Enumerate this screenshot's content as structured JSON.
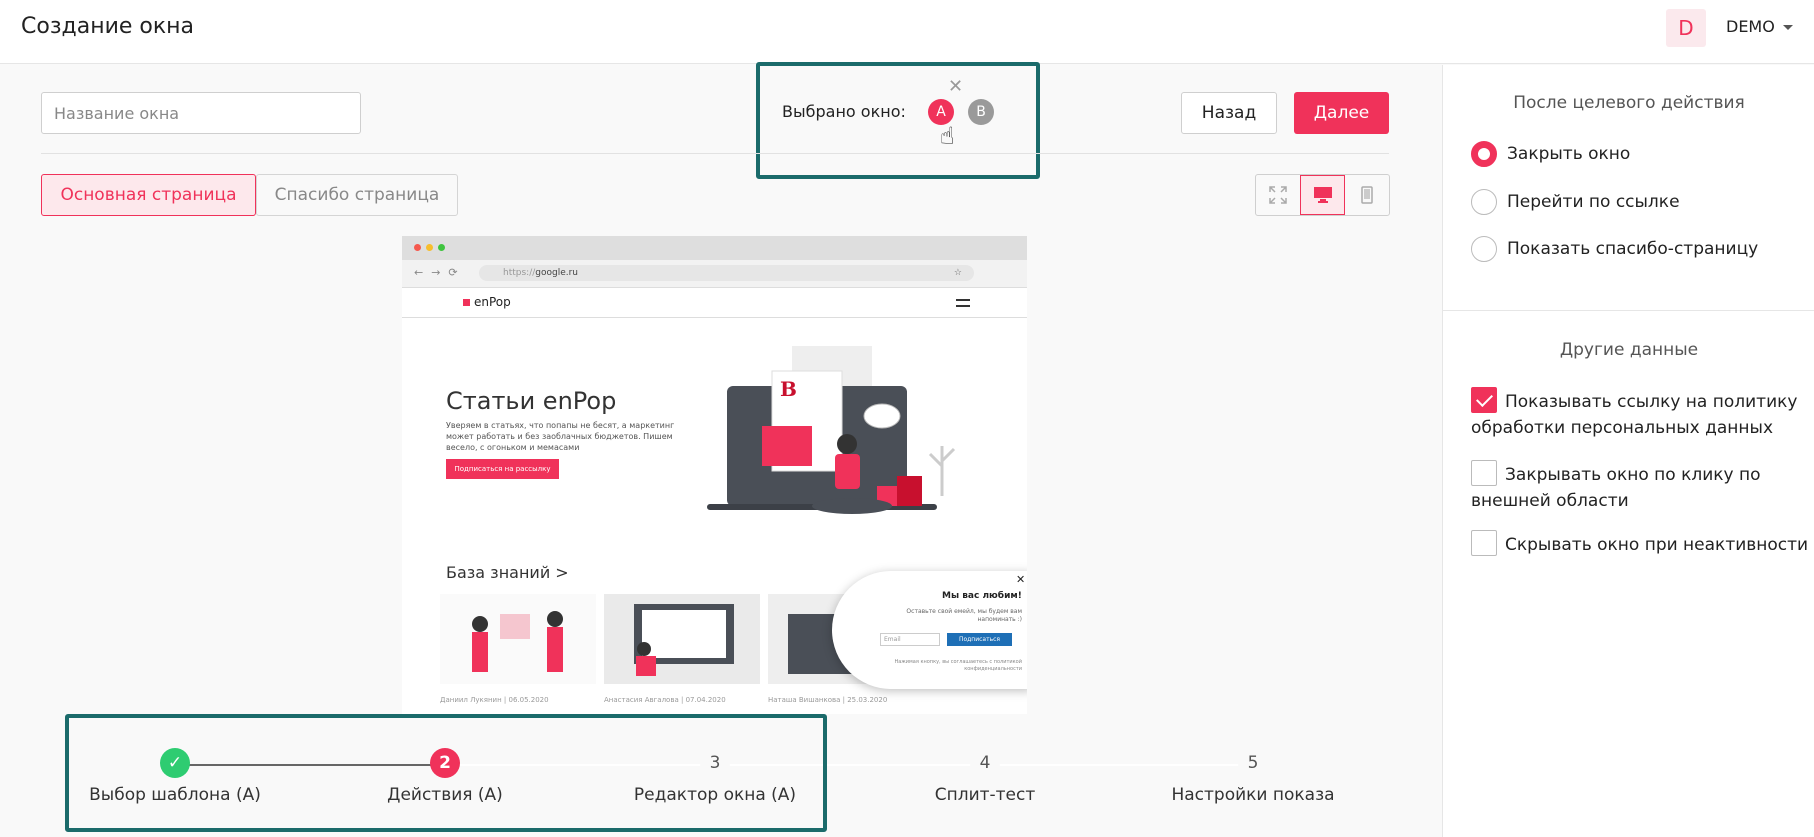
{
  "header": {
    "title": "Создание окна",
    "avatar_letter": "D",
    "account_name": "DEMO"
  },
  "toolbar": {
    "name_placeholder": "Название окна",
    "selected_label": "Выбрано окно:",
    "variant_a": "A",
    "variant_b": "B",
    "back_label": "Назад",
    "next_label": "Далее"
  },
  "tabs": [
    {
      "label": "Основная страница",
      "active": true
    },
    {
      "label": "Спасибо страница",
      "active": false
    }
  ],
  "view_modes": [
    "fullscreen-icon",
    "desktop-icon",
    "mobile-icon"
  ],
  "preview": {
    "url_scheme": "https://",
    "url_host": "google.ru",
    "site_logo": "enPop",
    "hero_title": "Статьи enPop",
    "hero_text": "Уверяем в статьях, что попапы не бесят, а маркетинг может работать и без заоблачных бюджетов. Пишем весело, с огоньком и мемасами",
    "hero_button": "Подписаться на рассылку",
    "kb_title": "База знаний >",
    "cards": [
      {
        "caption": "Даниил Лукянин | 06.05.2020"
      },
      {
        "caption": "Анастасия Авгалова | 07.04.2020"
      },
      {
        "caption": "Наташа Вишанкова | 25.03.2020"
      }
    ],
    "popup": {
      "title": "Мы вас любим!",
      "text": "Оставьте свой емейл, мы будем вам напоминать :)",
      "input_placeholder": "Email",
      "button": "Подписаться",
      "note": "Нажимая кнопку, вы соглашаетесь с политикой конфиденциальности"
    }
  },
  "steps": [
    {
      "number": "✓",
      "label": "Выбор шаблона (А)",
      "state": "done"
    },
    {
      "number": "2",
      "label": "Действия (А)",
      "state": "current"
    },
    {
      "number": "3",
      "label": "Редактор окна (А)",
      "state": "pending"
    },
    {
      "number": "4",
      "label": "Сплит-тест",
      "state": "pending"
    },
    {
      "number": "5",
      "label": "Настройки показа",
      "state": "pending"
    }
  ],
  "after_action": {
    "title": "После целевого действия",
    "options": [
      {
        "label": "Закрыть окно",
        "checked": true
      },
      {
        "label": "Перейти по ссылке",
        "checked": false
      },
      {
        "label": "Показать спасибо-страницу",
        "checked": false
      }
    ]
  },
  "other_data": {
    "title": "Другие данные",
    "options": [
      {
        "label": "Показывать ссылку на политику обработки персональных данных",
        "checked": true
      },
      {
        "label": "Закрывать окно по клику по внешней области",
        "checked": false
      },
      {
        "label": "Скрывать окно при неактивности",
        "checked": false
      }
    ]
  },
  "colors": {
    "accent": "#f0325a",
    "highlight_border": "#1b6b6b",
    "success": "#2ecc71"
  }
}
